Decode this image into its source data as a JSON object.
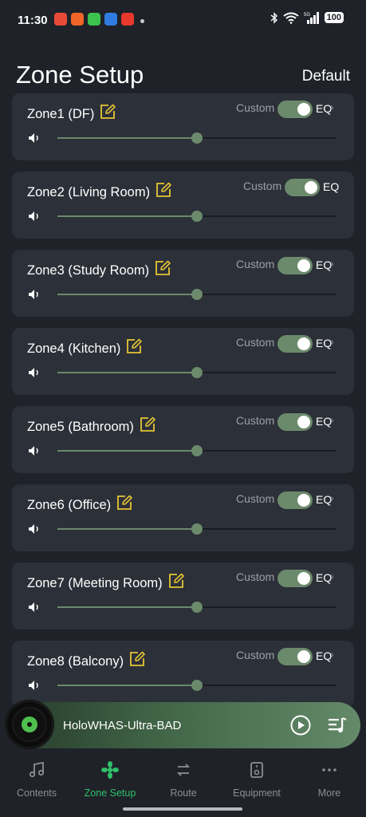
{
  "status_bar": {
    "time": "11:30",
    "battery": "100",
    "network": "5G"
  },
  "header": {
    "title": "Zone Setup",
    "default_label": "Default"
  },
  "zones": [
    {
      "name": "Zone1 (DF)",
      "custom_label": "Custom",
      "eq_label": "EQ",
      "eq_enabled": true,
      "volume": 0.5,
      "chevron": "›"
    },
    {
      "name": "Zone2 (Living Room)",
      "custom_label": "Custom",
      "eq_label": "EQ",
      "eq_enabled": true,
      "volume": 0.5,
      "chevron": ""
    },
    {
      "name": "Zone3 (Study Room)",
      "custom_label": "Custom",
      "eq_label": "EQ",
      "eq_enabled": true,
      "volume": 0.5,
      "chevron": "›"
    },
    {
      "name": "Zone4 (Kitchen)",
      "custom_label": "Custom",
      "eq_label": "EQ",
      "eq_enabled": true,
      "volume": 0.5,
      "chevron": "›"
    },
    {
      "name": "Zone5 (Bathroom)",
      "custom_label": "Custom",
      "eq_label": "EQ",
      "eq_enabled": true,
      "volume": 0.5,
      "chevron": "›"
    },
    {
      "name": "Zone6 (Office)",
      "custom_label": "Custom",
      "eq_label": "EQ",
      "eq_enabled": true,
      "volume": 0.5,
      "chevron": "›"
    },
    {
      "name": "Zone7 (Meeting Room)",
      "custom_label": "Custom",
      "eq_label": "EQ",
      "eq_enabled": true,
      "volume": 0.5,
      "chevron": "›"
    },
    {
      "name": "Zone8 (Balcony)",
      "custom_label": "Custom",
      "eq_label": "EQ",
      "eq_enabled": true,
      "volume": 0.5,
      "chevron": "›"
    }
  ],
  "player": {
    "track": "HoloWHAS-Ultra-BAD"
  },
  "nav": {
    "items": [
      {
        "label": "Contents",
        "icon": "music-note-icon"
      },
      {
        "label": "Zone Setup",
        "icon": "zone-setup-icon",
        "active": true
      },
      {
        "label": "Route",
        "icon": "route-icon"
      },
      {
        "label": "Equipment",
        "icon": "equipment-icon"
      },
      {
        "label": "More",
        "icon": "more-icon"
      }
    ]
  },
  "colors": {
    "accent_green": "#2fc16b",
    "toggle_on": "#6b8a6c",
    "edit_icon": "#e6c535",
    "card_bg": "#2c3038",
    "page_bg": "#1f2228"
  }
}
